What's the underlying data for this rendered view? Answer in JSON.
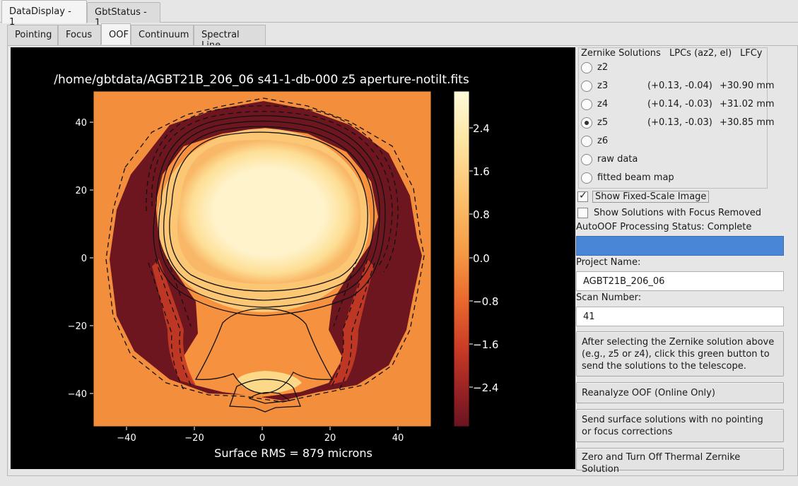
{
  "top_tabs": [
    {
      "label": "DataDisplay - 1",
      "active": true
    },
    {
      "label": "GbtStatus - 1",
      "active": false
    }
  ],
  "sub_tabs": [
    {
      "label": "Pointing",
      "active": false
    },
    {
      "label": "Focus",
      "active": false
    },
    {
      "label": "OOF",
      "active": true
    },
    {
      "label": "Continuum",
      "active": false
    },
    {
      "label": "Spectral Line",
      "active": false
    }
  ],
  "plot": {
    "title": "/home/gbtdata/AGBT21B_206_06 s41-1-db-000 z5 aperture-notilt.fits",
    "caption": "Surface RMS = 879 microns",
    "x_ticks": [
      "−40",
      "−20",
      "0",
      "20",
      "40"
    ],
    "y_ticks": [
      "40",
      "20",
      "0",
      "−20",
      "−40"
    ],
    "colorbar_ticks": [
      "2.4",
      "1.6",
      "0.8",
      "0.0",
      "−0.8",
      "−1.6",
      "−2.4"
    ],
    "colors": {
      "background": "#f38e3d",
      "outer": "#6e1620",
      "core": "#fff2c8",
      "bright": "#fcd989"
    }
  },
  "zernike": {
    "header": {
      "solutions": "Zernike Solutions",
      "lpcs": "LPCs (az2, el)",
      "lfcy": "LFCy"
    },
    "options": [
      {
        "label": "z2",
        "lpc": "",
        "lfcy": "",
        "checked": false
      },
      {
        "label": "z3",
        "lpc": "(+0.13, -0.04)",
        "lfcy": "+30.90 mm",
        "checked": false
      },
      {
        "label": "z4",
        "lpc": "(+0.14, -0.03)",
        "lfcy": "+31.02 mm",
        "checked": false
      },
      {
        "label": "z5",
        "lpc": "(+0.13, -0.03)",
        "lfcy": "+30.85 mm",
        "checked": true
      },
      {
        "label": "z6",
        "lpc": "",
        "lfcy": "",
        "checked": false
      },
      {
        "label": "raw data",
        "lpc": "",
        "lfcy": "",
        "checked": false
      },
      {
        "label": "fitted beam map",
        "lpc": "",
        "lfcy": "",
        "checked": false
      }
    ]
  },
  "checks": {
    "fixed_scale": {
      "label": "Show Fixed-Scale Image",
      "checked": true
    },
    "focus_removed": {
      "label": "Show Solutions with Focus Removed",
      "checked": false
    }
  },
  "status": {
    "label": "AutoOOF Processing Status: Complete",
    "color": "#4a86d6"
  },
  "project": {
    "label": "Project Name:",
    "value": "AGBT21B_206_06"
  },
  "scan": {
    "label": "Scan Number:",
    "value": "41"
  },
  "buttons": {
    "send_solutions": "After selecting the Zernike solution above\n (e.g., z5 or z4), click this green button to\nsend the solutions to the telescope.",
    "reanalyze": "Reanalyze OOF (Online Only)",
    "send_surface": "Send surface solutions with no pointing\n or focus corrections",
    "zero_thermal": "Zero and Turn Off Thermal Zernike Solution"
  }
}
